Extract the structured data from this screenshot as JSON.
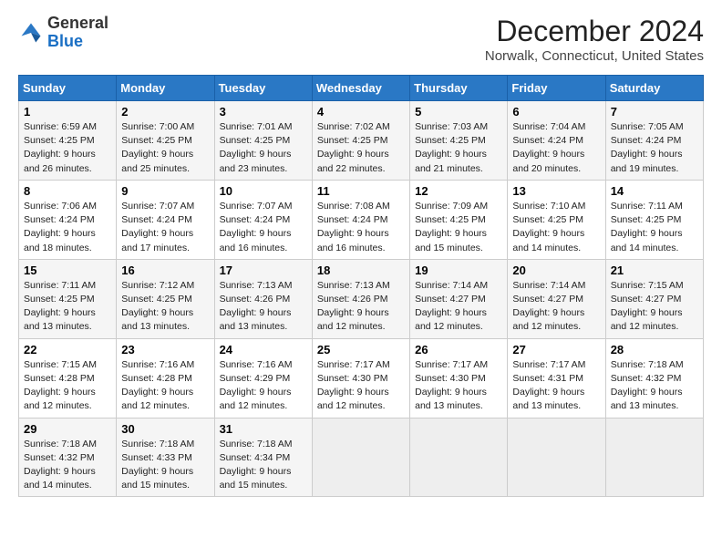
{
  "logo": {
    "general": "General",
    "blue": "Blue"
  },
  "title": "December 2024",
  "subtitle": "Norwalk, Connecticut, United States",
  "days_header": [
    "Sunday",
    "Monday",
    "Tuesday",
    "Wednesday",
    "Thursday",
    "Friday",
    "Saturday"
  ],
  "weeks": [
    [
      {
        "day": "1",
        "sunrise": "6:59 AM",
        "sunset": "4:25 PM",
        "daylight": "9 hours and 26 minutes."
      },
      {
        "day": "2",
        "sunrise": "7:00 AM",
        "sunset": "4:25 PM",
        "daylight": "9 hours and 25 minutes."
      },
      {
        "day": "3",
        "sunrise": "7:01 AM",
        "sunset": "4:25 PM",
        "daylight": "9 hours and 23 minutes."
      },
      {
        "day": "4",
        "sunrise": "7:02 AM",
        "sunset": "4:25 PM",
        "daylight": "9 hours and 22 minutes."
      },
      {
        "day": "5",
        "sunrise": "7:03 AM",
        "sunset": "4:25 PM",
        "daylight": "9 hours and 21 minutes."
      },
      {
        "day": "6",
        "sunrise": "7:04 AM",
        "sunset": "4:24 PM",
        "daylight": "9 hours and 20 minutes."
      },
      {
        "day": "7",
        "sunrise": "7:05 AM",
        "sunset": "4:24 PM",
        "daylight": "9 hours and 19 minutes."
      }
    ],
    [
      {
        "day": "8",
        "sunrise": "7:06 AM",
        "sunset": "4:24 PM",
        "daylight": "9 hours and 18 minutes."
      },
      {
        "day": "9",
        "sunrise": "7:07 AM",
        "sunset": "4:24 PM",
        "daylight": "9 hours and 17 minutes."
      },
      {
        "day": "10",
        "sunrise": "7:07 AM",
        "sunset": "4:24 PM",
        "daylight": "9 hours and 16 minutes."
      },
      {
        "day": "11",
        "sunrise": "7:08 AM",
        "sunset": "4:24 PM",
        "daylight": "9 hours and 16 minutes."
      },
      {
        "day": "12",
        "sunrise": "7:09 AM",
        "sunset": "4:25 PM",
        "daylight": "9 hours and 15 minutes."
      },
      {
        "day": "13",
        "sunrise": "7:10 AM",
        "sunset": "4:25 PM",
        "daylight": "9 hours and 14 minutes."
      },
      {
        "day": "14",
        "sunrise": "7:11 AM",
        "sunset": "4:25 PM",
        "daylight": "9 hours and 14 minutes."
      }
    ],
    [
      {
        "day": "15",
        "sunrise": "7:11 AM",
        "sunset": "4:25 PM",
        "daylight": "9 hours and 13 minutes."
      },
      {
        "day": "16",
        "sunrise": "7:12 AM",
        "sunset": "4:25 PM",
        "daylight": "9 hours and 13 minutes."
      },
      {
        "day": "17",
        "sunrise": "7:13 AM",
        "sunset": "4:26 PM",
        "daylight": "9 hours and 13 minutes."
      },
      {
        "day": "18",
        "sunrise": "7:13 AM",
        "sunset": "4:26 PM",
        "daylight": "9 hours and 12 minutes."
      },
      {
        "day": "19",
        "sunrise": "7:14 AM",
        "sunset": "4:27 PM",
        "daylight": "9 hours and 12 minutes."
      },
      {
        "day": "20",
        "sunrise": "7:14 AM",
        "sunset": "4:27 PM",
        "daylight": "9 hours and 12 minutes."
      },
      {
        "day": "21",
        "sunrise": "7:15 AM",
        "sunset": "4:27 PM",
        "daylight": "9 hours and 12 minutes."
      }
    ],
    [
      {
        "day": "22",
        "sunrise": "7:15 AM",
        "sunset": "4:28 PM",
        "daylight": "9 hours and 12 minutes."
      },
      {
        "day": "23",
        "sunrise": "7:16 AM",
        "sunset": "4:28 PM",
        "daylight": "9 hours and 12 minutes."
      },
      {
        "day": "24",
        "sunrise": "7:16 AM",
        "sunset": "4:29 PM",
        "daylight": "9 hours and 12 minutes."
      },
      {
        "day": "25",
        "sunrise": "7:17 AM",
        "sunset": "4:30 PM",
        "daylight": "9 hours and 12 minutes."
      },
      {
        "day": "26",
        "sunrise": "7:17 AM",
        "sunset": "4:30 PM",
        "daylight": "9 hours and 13 minutes."
      },
      {
        "day": "27",
        "sunrise": "7:17 AM",
        "sunset": "4:31 PM",
        "daylight": "9 hours and 13 minutes."
      },
      {
        "day": "28",
        "sunrise": "7:18 AM",
        "sunset": "4:32 PM",
        "daylight": "9 hours and 13 minutes."
      }
    ],
    [
      {
        "day": "29",
        "sunrise": "7:18 AM",
        "sunset": "4:32 PM",
        "daylight": "9 hours and 14 minutes."
      },
      {
        "day": "30",
        "sunrise": "7:18 AM",
        "sunset": "4:33 PM",
        "daylight": "9 hours and 15 minutes."
      },
      {
        "day": "31",
        "sunrise": "7:18 AM",
        "sunset": "4:34 PM",
        "daylight": "9 hours and 15 minutes."
      },
      null,
      null,
      null,
      null
    ]
  ]
}
